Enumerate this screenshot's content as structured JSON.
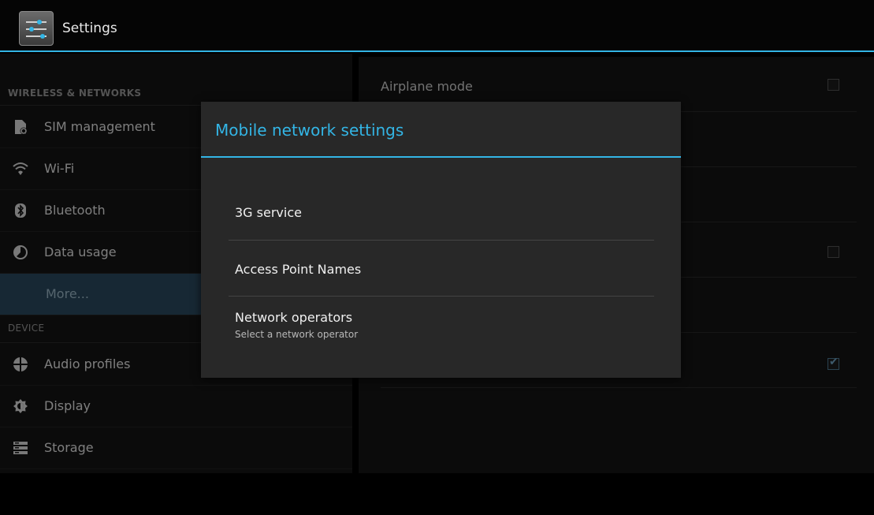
{
  "action_bar": {
    "title": "Settings",
    "icon": "settings-sliders-icon",
    "accent_color": "#33b5e5"
  },
  "left_pane": {
    "sections": [
      {
        "header": "WIRELESS & NETWORKS"
      },
      {
        "header": "DEVICE"
      }
    ],
    "items": [
      {
        "label": "SIM management",
        "icon": "sim-icon"
      },
      {
        "label": "Wi-Fi",
        "icon": "wifi-icon"
      },
      {
        "label": "Bluetooth",
        "icon": "bluetooth-icon"
      },
      {
        "label": "Data usage",
        "icon": "data-usage-icon"
      },
      {
        "label": "More...",
        "icon": "",
        "selected": true
      },
      {
        "label": "Audio profiles",
        "icon": "audio-profiles-icon"
      },
      {
        "label": "Display",
        "icon": "display-icon"
      },
      {
        "label": "Storage",
        "icon": "storage-icon"
      }
    ]
  },
  "right_pane": {
    "rows": [
      {
        "label": "Airplane mode",
        "checkbox": "unchecked"
      },
      {
        "label": "",
        "checkbox": "none"
      },
      {
        "label": "",
        "checkbox": "none"
      },
      {
        "label": "",
        "checkbox": "unchecked"
      },
      {
        "label": "",
        "checkbox": "none"
      },
      {
        "label": "",
        "checkbox": "checked"
      }
    ]
  },
  "dialog": {
    "title": "Mobile network settings",
    "items": [
      {
        "label": "3G service",
        "summary": ""
      },
      {
        "label": "Access Point Names",
        "summary": ""
      },
      {
        "label": "Network operators",
        "summary": "Select a network operator"
      }
    ]
  }
}
